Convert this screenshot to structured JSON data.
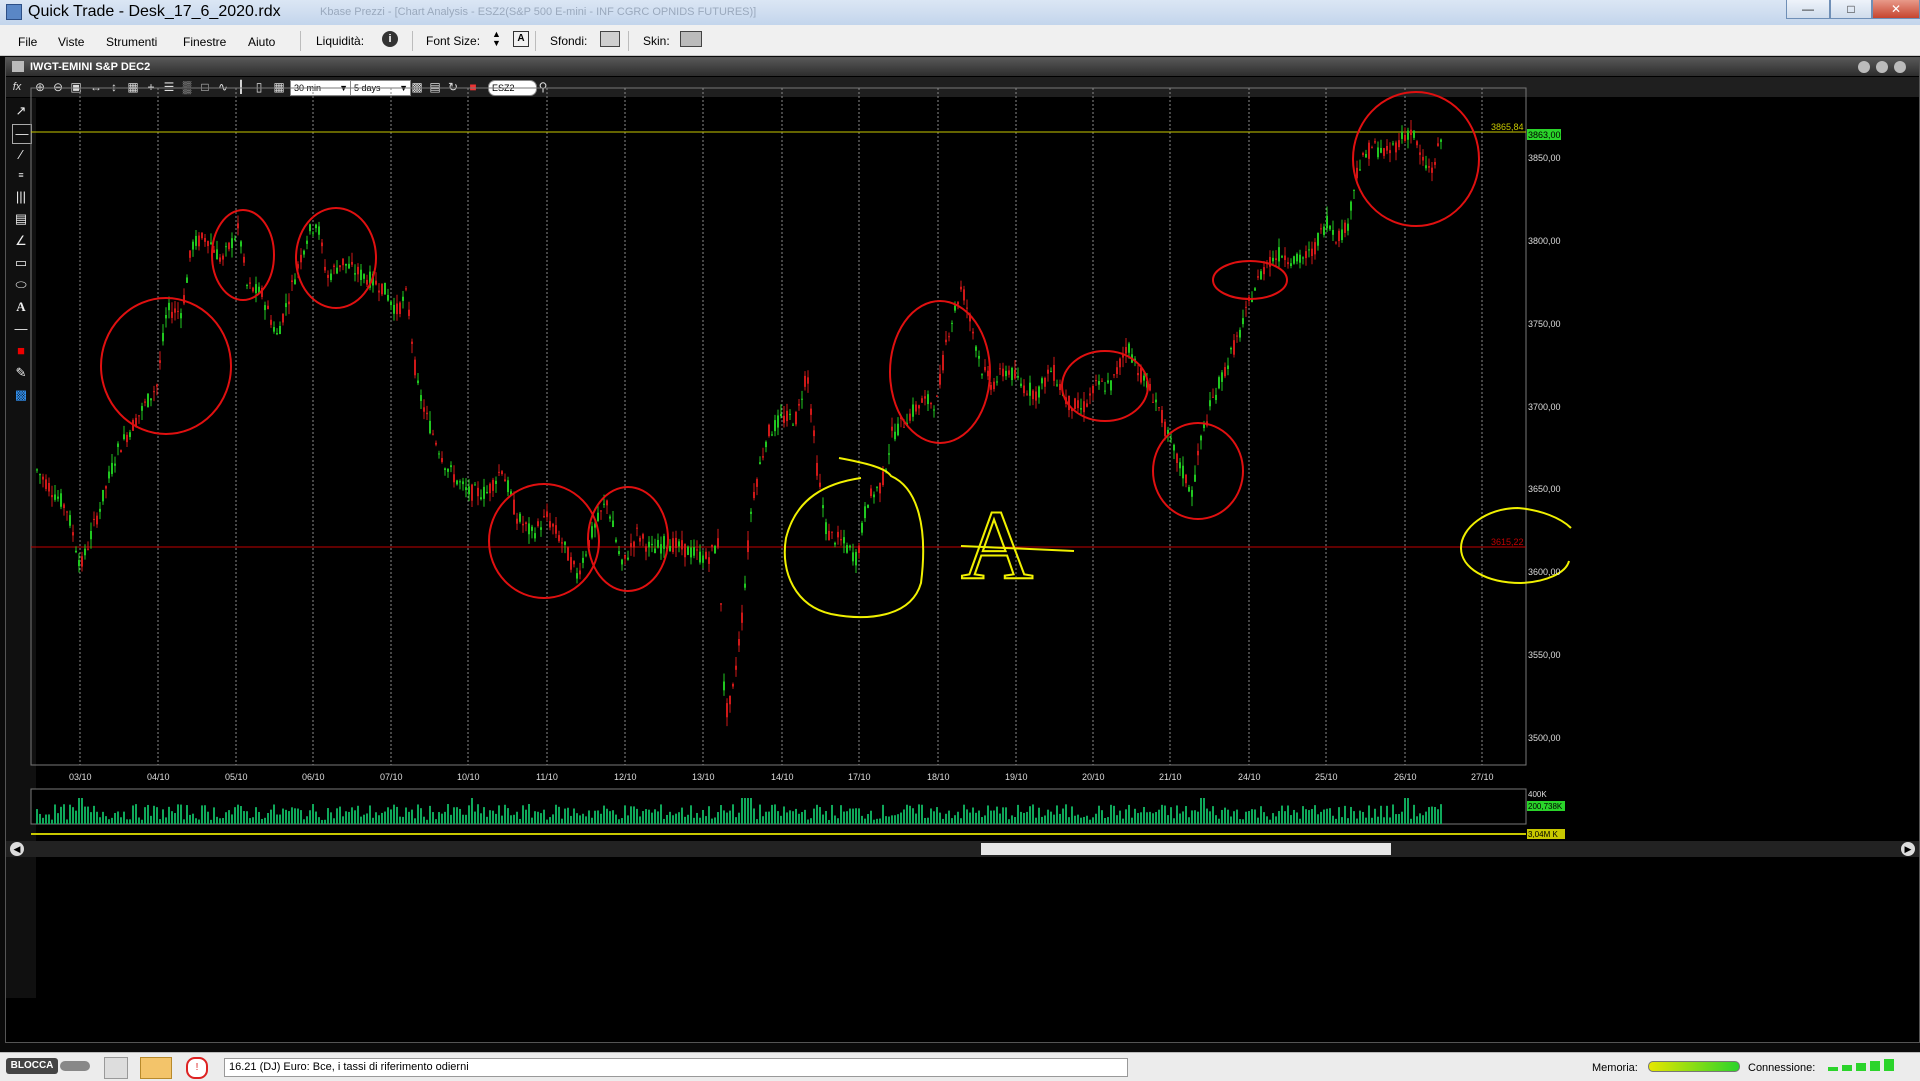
{
  "window": {
    "title": "Quick Trade - Desk_17_6_2020.rdx",
    "title_watermark": "Kbase Prezzi - [Chart Analysis - ESZ2(S&P 500 E-mini - INF CGRC OPNIDS FUTURES)]"
  },
  "menu": {
    "items": [
      "File",
      "Viste",
      "Strumenti",
      "Finestre",
      "Aiuto"
    ],
    "liquidity_label": "Liquidità:",
    "font_size_label": "Font Size:",
    "backgrounds_label": "Sfondi:",
    "skin_label": "Skin:"
  },
  "chart": {
    "instrument_title": "IWGT-EMINI S&P DEC2",
    "toolbar": {
      "interval": "30 min",
      "range": "5 days",
      "symbol": "ESZ2"
    },
    "price_axis": [
      "3850,00",
      "3800,00",
      "3750,00",
      "3700,00",
      "3650,00",
      "3600,00",
      "3550,00",
      "3500,00"
    ],
    "date_labels": [
      "03/10",
      "04/10",
      "05/10",
      "06/10",
      "07/10",
      "10/10",
      "11/10",
      "12/10",
      "13/10",
      "14/10",
      "17/10",
      "18/10",
      "19/10",
      "20/10",
      "21/10",
      "24/10",
      "25/10",
      "26/10",
      "27/10"
    ],
    "hline_top": {
      "label": "3865,84",
      "color": "#c8c800"
    },
    "hline_bottom": {
      "label": "3615,22",
      "color": "#c00000"
    },
    "last_price": {
      "label": "3863,00",
      "color": "#2ad42a"
    },
    "volume_axis": [
      "400K",
      "200,738K"
    ],
    "volume_extra": "3,04M K",
    "annotation_letter": "A",
    "chart_data": {
      "type": "candlestick",
      "ylim": [
        3480,
        3890
      ],
      "candles": []
    }
  },
  "status": {
    "lock_label": "BLOCCA",
    "news": "16.21 (DJ) Euro: Bce, i tassi di riferimento odierni",
    "memory_label": "Memoria:",
    "connection_label": "Connessione:"
  },
  "colors": {
    "up": "#20c820",
    "down": "#d01818",
    "volume": "#0fa85a",
    "annotation_red": "#e01010",
    "annotation_yellow": "#f0f000",
    "grid": "#8a8a8a"
  }
}
